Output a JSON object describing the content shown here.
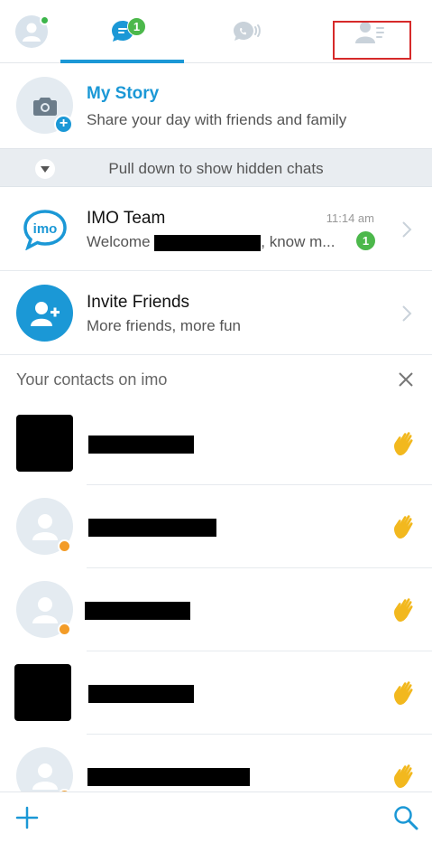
{
  "tabs": {
    "chats_badge": "1"
  },
  "story": {
    "title": "My Story",
    "subtitle": "Share your day with friends and family"
  },
  "hidden_chats": {
    "label": "Pull down to show hidden chats"
  },
  "chats": [
    {
      "name": "IMO Team",
      "preview_prefix": "Welcome",
      "preview_suffix": ", know m...",
      "time": "11:14 am",
      "unread": "1",
      "logo_text": "imo"
    },
    {
      "name": "Invite Friends",
      "preview": "More friends, more fun"
    }
  ],
  "contacts_section": {
    "title": "Your contacts on imo"
  },
  "contacts": [
    {
      "avatar": "redacted",
      "status": "none",
      "action_icon": "wave-icon"
    },
    {
      "avatar": "placeholder",
      "status": "pending",
      "action_icon": "wave-icon"
    },
    {
      "avatar": "placeholder",
      "status": "pending",
      "action_icon": "wave-icon"
    },
    {
      "avatar": "redacted",
      "status": "none",
      "action_icon": "wave-icon"
    },
    {
      "avatar": "placeholder",
      "status": "pending",
      "action_icon": "wave-icon"
    }
  ],
  "colors": {
    "accent": "#1b98d6",
    "badge": "#4cb84b",
    "wave": "#f2b81e",
    "highlight": "#d62a2a"
  }
}
